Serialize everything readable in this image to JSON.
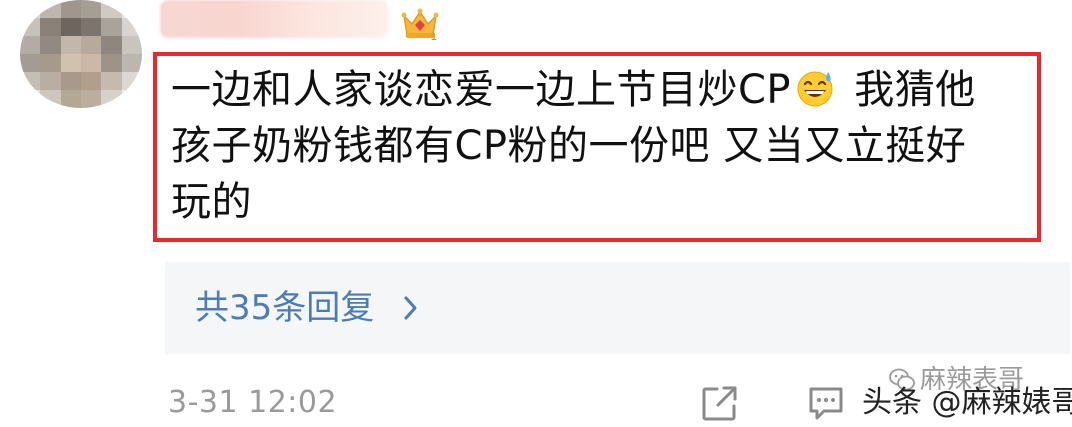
{
  "comment": {
    "lines": [
      "一边和人家谈恋爱一边上节目炒CP",
      " 我猜他",
      "孩子奶粉钱都有CP粉的一份吧 又当又立挺好",
      "玩的"
    ],
    "emoji_icon": "grinning-sweat-emoji"
  },
  "replies": {
    "label": "共35条回复",
    "chevron_icon": "chevron-right-icon"
  },
  "footer": {
    "timestamp": "3-31 12:02",
    "share_icon": "share-icon",
    "comment_icon": "comment-icon",
    "watermark_top": "麻辣表哥",
    "watermark_bottom": "头条 @麻辣婊哥"
  },
  "colors": {
    "highlight_border": "#e8292c",
    "reply_link": "#4a7cb5",
    "reply_bg": "#f5f6f8",
    "meta_text": "#9a9a9a"
  }
}
